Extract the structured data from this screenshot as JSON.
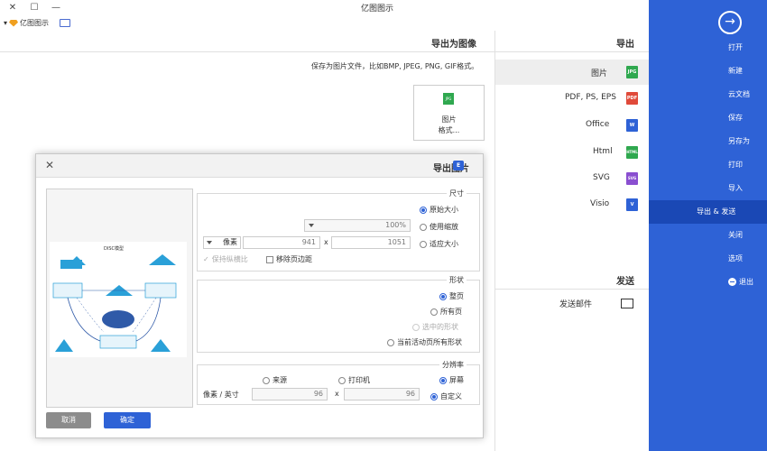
{
  "app": {
    "title": "亿图图示",
    "account": "亿图图示"
  },
  "sidebar": {
    "items": [
      {
        "label": "打开"
      },
      {
        "label": "新建"
      },
      {
        "label": "云文档"
      },
      {
        "label": "保存"
      },
      {
        "label": "另存为"
      },
      {
        "label": "打印"
      },
      {
        "label": "导入"
      },
      {
        "label": "导出 & 发送"
      },
      {
        "label": "关闭"
      },
      {
        "label": "选项"
      },
      {
        "label": "退出"
      }
    ]
  },
  "export": {
    "heading": "导出",
    "items": [
      {
        "label": "图片",
        "icon": "JPG",
        "color": "#2fa84f"
      },
      {
        "label": "PDF, PS, EPS",
        "icon": "PDF",
        "color": "#e04a3a"
      },
      {
        "label": "Office",
        "icon": "W",
        "color": "#2e62d6"
      },
      {
        "label": "Html",
        "icon": "HTML",
        "color": "#2fa84f"
      },
      {
        "label": "SVG",
        "icon": "SVG",
        "color": "#8a4fd0"
      },
      {
        "label": "Visio",
        "icon": "V",
        "color": "#2e62d6"
      }
    ]
  },
  "send": {
    "heading": "发送",
    "email": "发送邮件"
  },
  "main": {
    "title": "导出为图像",
    "description": "保存为图片文件，比如BMP, JPEG, PNG, GIF格式。",
    "card": {
      "line1": "图片",
      "line2": "格式..."
    }
  },
  "dialog": {
    "title": "导出图片",
    "size": {
      "label": "尺寸",
      "original": "原始大小",
      "zoom_label": "使用缩放",
      "zoom_value": "100%",
      "fit_label": "适应大小",
      "width": "1051",
      "height": "941",
      "unit": "像素",
      "keep_ratio": "保持纵横比",
      "remove_margin": "移除页边距"
    },
    "shape": {
      "label": "形状",
      "current_page": "整页",
      "all_pages": "所有页",
      "selected": "选中的形状",
      "current_all": "当前活动页所有形状"
    },
    "resolution": {
      "label": "分辨率",
      "screen": "屏幕",
      "printer": "打印机",
      "source": "来源",
      "custom": "自定义",
      "dpi_x": "96",
      "dpi_y": "96",
      "unit": "像素 / 英寸"
    },
    "ok": "确定",
    "cancel": "取消",
    "preview_title": "DISC模型"
  }
}
